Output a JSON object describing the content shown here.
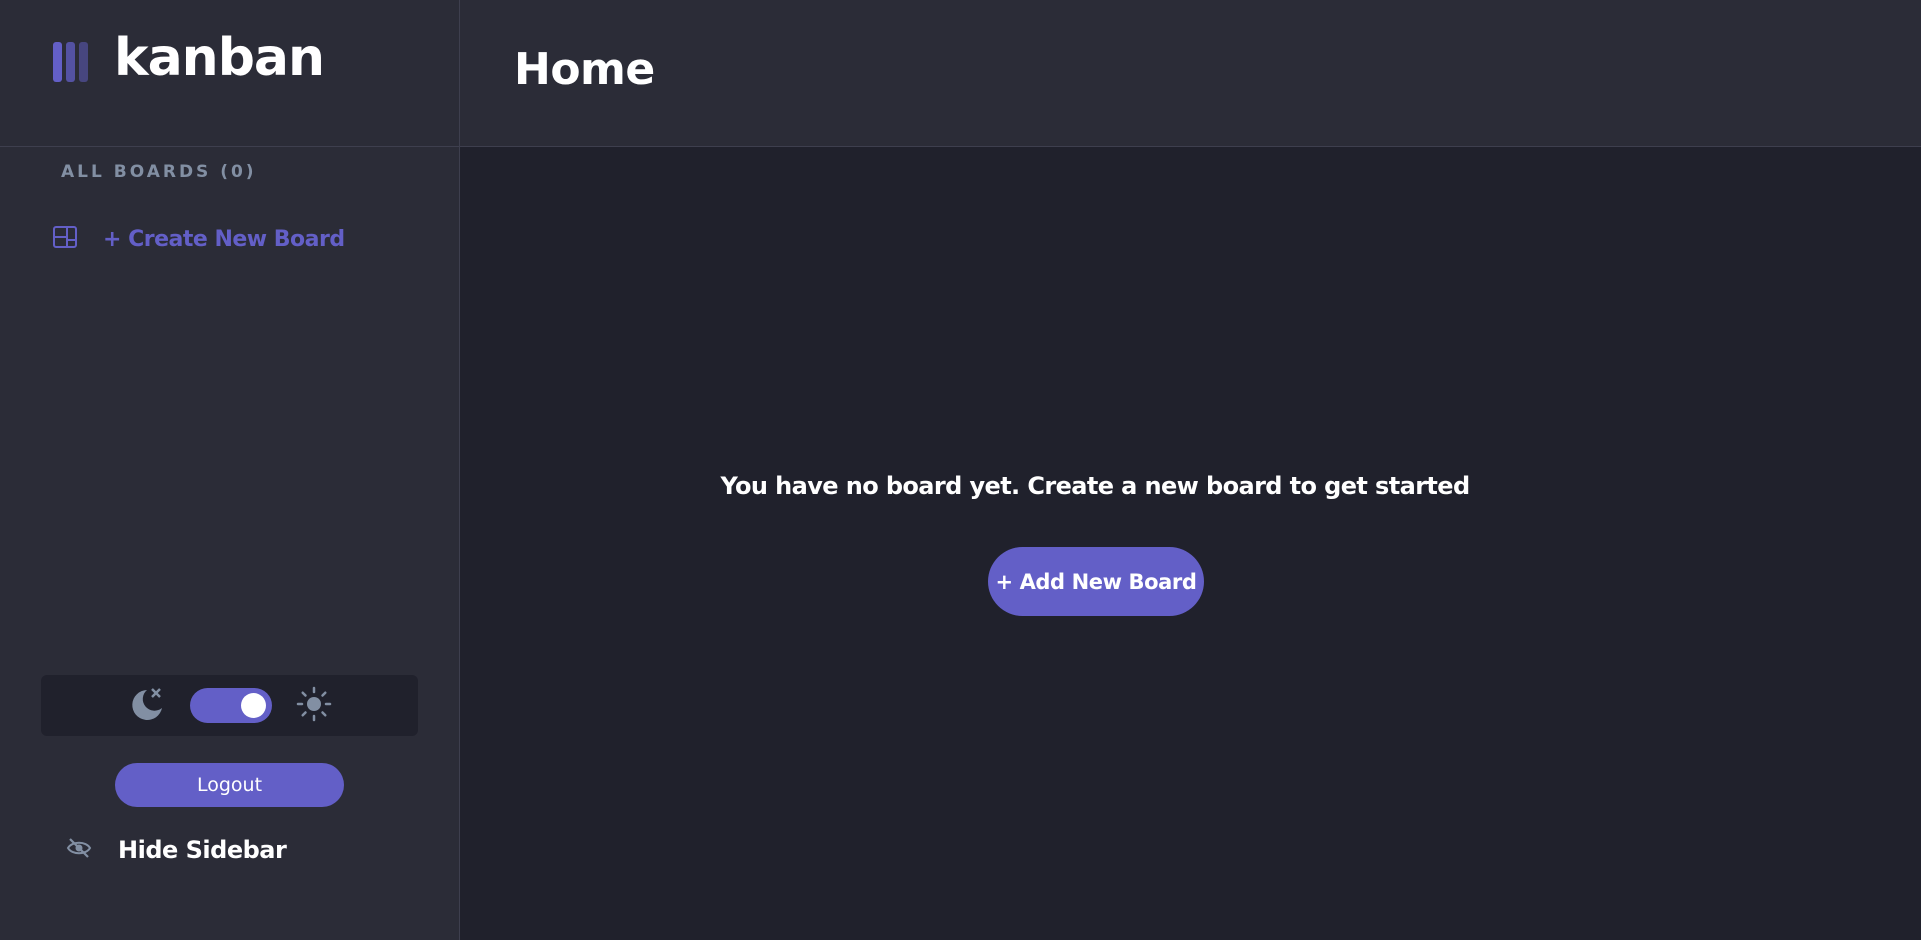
{
  "app": {
    "logo_text": "kanban",
    "accent_color": "#635fc7"
  },
  "header": {
    "title": "Home"
  },
  "sidebar": {
    "boards_heading": "ALL BOARDS (0)",
    "create_board_label": "+ Create New Board",
    "theme": {
      "mode": "dark",
      "dark_icon": "moon-icon",
      "light_icon": "sun-icon"
    },
    "logout_label": "Logout",
    "hide_sidebar_label": "Hide Sidebar"
  },
  "main": {
    "empty_message": "You have no board yet. Create a new board to get started",
    "add_board_label": "+ Add New Board"
  }
}
